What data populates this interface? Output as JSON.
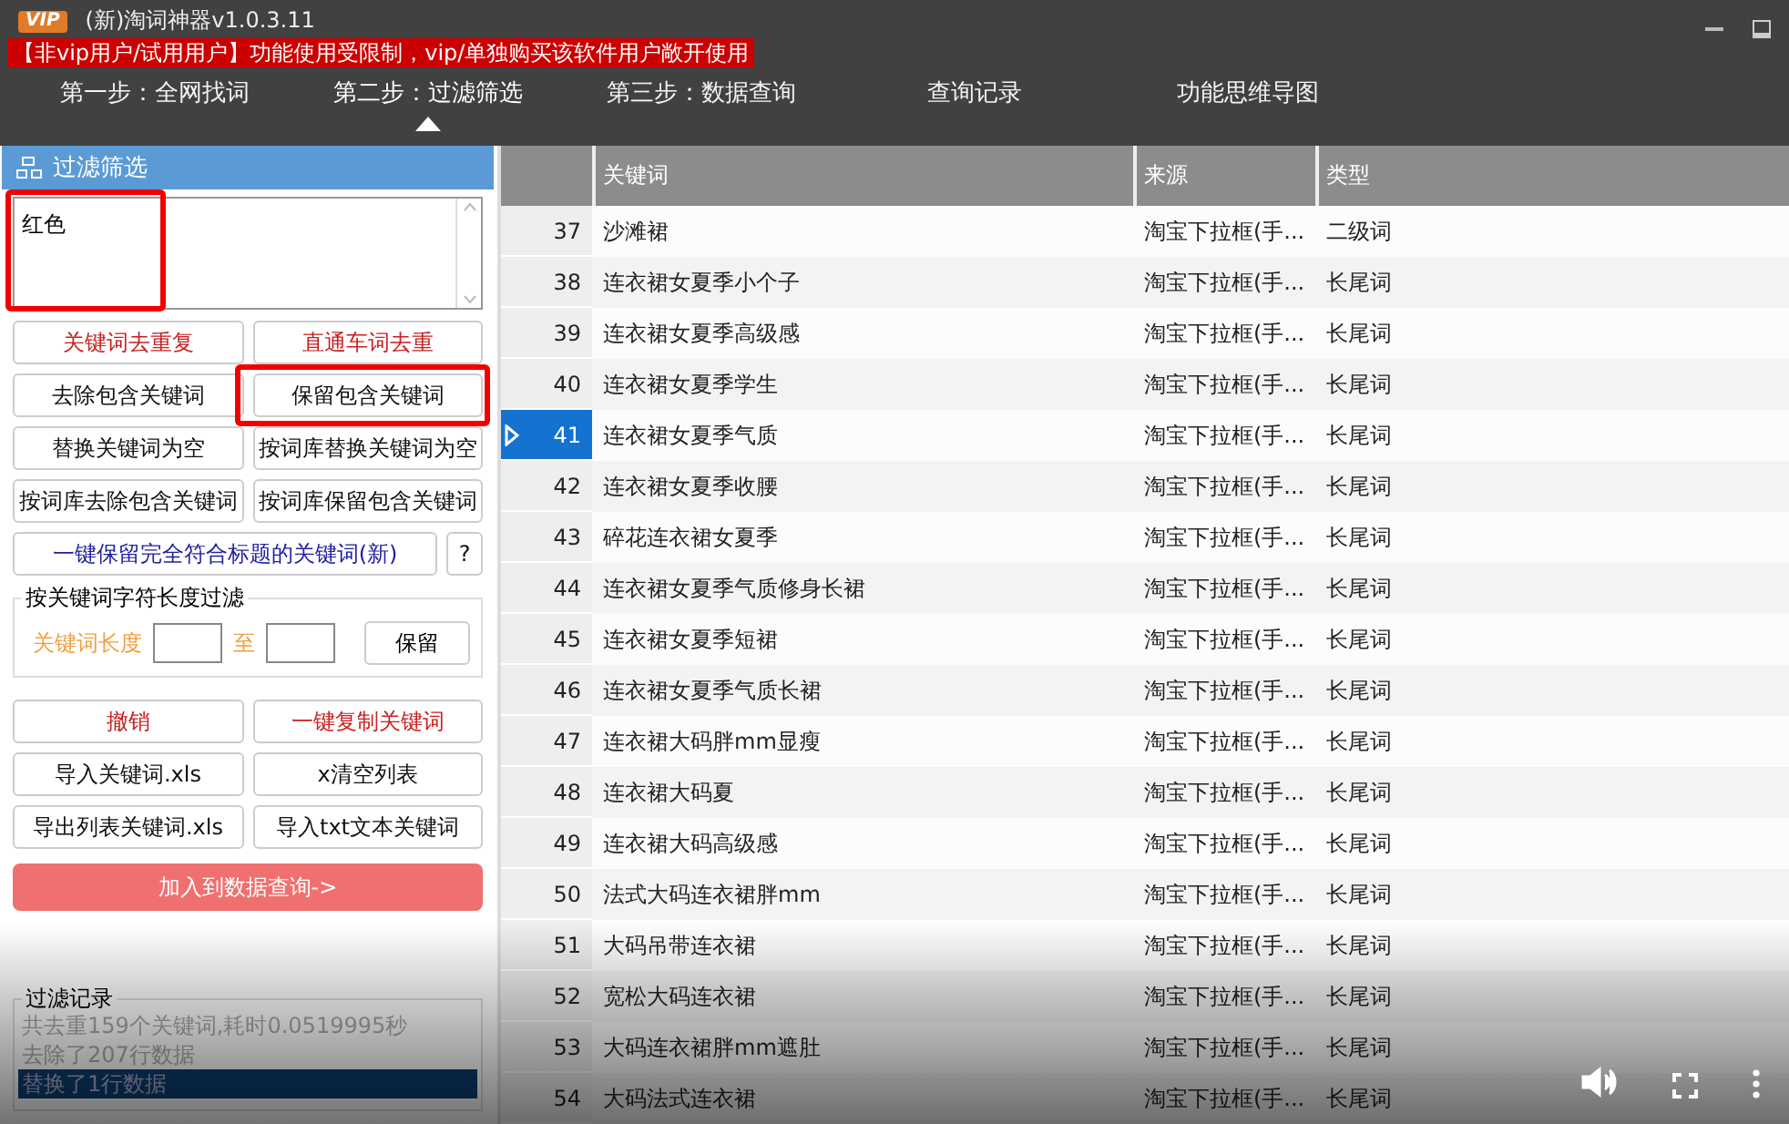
{
  "window": {
    "logo": "VIP",
    "title": "(新)淘词神器v1.0.3.11",
    "notice": "【非vip用户/试用用户】功能使用受限制，vip/单独购买该软件用户敞开使用"
  },
  "steps": [
    {
      "label": "第一步：全网找词",
      "selected": false
    },
    {
      "label": "第二步：过滤筛选",
      "selected": true
    },
    {
      "label": "第三步：数据查询",
      "selected": false
    },
    {
      "label": "查询记录",
      "selected": false
    },
    {
      "label": "功能思维导图",
      "selected": false
    }
  ],
  "filter_panel": {
    "title": "过滤筛选",
    "keywords_value": "红色",
    "keywords_highlighted": true,
    "buttons": [
      {
        "label": "关键词去重复",
        "kind": "danger",
        "highlighted": false
      },
      {
        "label": "直通车词去重",
        "kind": "danger",
        "highlighted": false
      },
      {
        "label": "去除包含关键词",
        "kind": "normal",
        "highlighted": false
      },
      {
        "label": "保留包含关键词",
        "kind": "normal",
        "highlighted": true
      },
      {
        "label": "替换关键词为空",
        "kind": "normal",
        "highlighted": false
      },
      {
        "label": "按词库替换关键词为空",
        "kind": "normal",
        "highlighted": false
      },
      {
        "label": "按词库去除包含关键词",
        "kind": "normal",
        "highlighted": false
      },
      {
        "label": "按词库保留包含关键词",
        "kind": "normal",
        "highlighted": false
      }
    ],
    "wide_button": "一键保留完全符合标题的关键词(新)",
    "help_button": "?"
  },
  "length_filter": {
    "title": "按关键词字符长度过滤",
    "label": "关键词长度",
    "separator": "至",
    "button": "保留"
  },
  "actions": [
    {
      "label": "撤销",
      "kind": "danger"
    },
    {
      "label": "一键复制关键词",
      "kind": "danger"
    },
    {
      "label": "导入关键词.xls",
      "kind": "normal"
    },
    {
      "label": "x清空列表",
      "kind": "normal"
    },
    {
      "label": "导出列表关键词.xls",
      "kind": "normal"
    },
    {
      "label": "导入txt文本关键词",
      "kind": "normal"
    }
  ],
  "submit_button": "加入到数据查询->",
  "log": {
    "title": "过滤记录",
    "lines": [
      {
        "text": "共去重159个关键词,耗时0.0519995秒",
        "selected": false
      },
      {
        "text": "去除了207行数据",
        "selected": false
      },
      {
        "text": "替换了1行数据",
        "selected": true
      }
    ]
  },
  "table": {
    "columns": [
      "关键词",
      "来源",
      "类型"
    ],
    "rows": [
      {
        "index": "37",
        "keyword": "沙滩裙",
        "source": "淘宝下拉框(手...",
        "type": "二级词",
        "selected": false
      },
      {
        "index": "38",
        "keyword": "连衣裙女夏季小个子",
        "source": "淘宝下拉框(手...",
        "type": "长尾词",
        "selected": false
      },
      {
        "index": "39",
        "keyword": "连衣裙女夏季高级感",
        "source": "淘宝下拉框(手...",
        "type": "长尾词",
        "selected": false
      },
      {
        "index": "40",
        "keyword": "连衣裙女夏季学生",
        "source": "淘宝下拉框(手...",
        "type": "长尾词",
        "selected": false
      },
      {
        "index": "41",
        "keyword": "连衣裙女夏季气质",
        "source": "淘宝下拉框(手...",
        "type": "长尾词",
        "selected": true
      },
      {
        "index": "42",
        "keyword": "连衣裙女夏季收腰",
        "source": "淘宝下拉框(手...",
        "type": "长尾词",
        "selected": false
      },
      {
        "index": "43",
        "keyword": "碎花连衣裙女夏季",
        "source": "淘宝下拉框(手...",
        "type": "长尾词",
        "selected": false
      },
      {
        "index": "44",
        "keyword": "连衣裙女夏季气质修身长裙",
        "source": "淘宝下拉框(手...",
        "type": "长尾词",
        "selected": false
      },
      {
        "index": "45",
        "keyword": "连衣裙女夏季短裙",
        "source": "淘宝下拉框(手...",
        "type": "长尾词",
        "selected": false
      },
      {
        "index": "46",
        "keyword": "连衣裙女夏季气质长裙",
        "source": "淘宝下拉框(手...",
        "type": "长尾词",
        "selected": false
      },
      {
        "index": "47",
        "keyword": "连衣裙大码胖mm显瘦",
        "source": "淘宝下拉框(手...",
        "type": "长尾词",
        "selected": false
      },
      {
        "index": "48",
        "keyword": "连衣裙大码夏",
        "source": "淘宝下拉框(手...",
        "type": "长尾词",
        "selected": false
      },
      {
        "index": "49",
        "keyword": "连衣裙大码高级感",
        "source": "淘宝下拉框(手...",
        "type": "长尾词",
        "selected": false
      },
      {
        "index": "50",
        "keyword": "法式大码连衣裙胖mm",
        "source": "淘宝下拉框(手...",
        "type": "长尾词",
        "selected": false
      },
      {
        "index": "51",
        "keyword": "大码吊带连衣裙",
        "source": "淘宝下拉框(手...",
        "type": "长尾词",
        "selected": false
      },
      {
        "index": "52",
        "keyword": "宽松大码连衣裙",
        "source": "淘宝下拉框(手...",
        "type": "长尾词",
        "selected": false
      },
      {
        "index": "53",
        "keyword": "大码连衣裙胖mm遮肚",
        "source": "淘宝下拉框(手...",
        "type": "长尾词",
        "selected": false
      },
      {
        "index": "54",
        "keyword": "大码法式连衣裙",
        "source": "淘宝下拉框(手...",
        "type": "长尾词",
        "selected": false
      }
    ]
  }
}
